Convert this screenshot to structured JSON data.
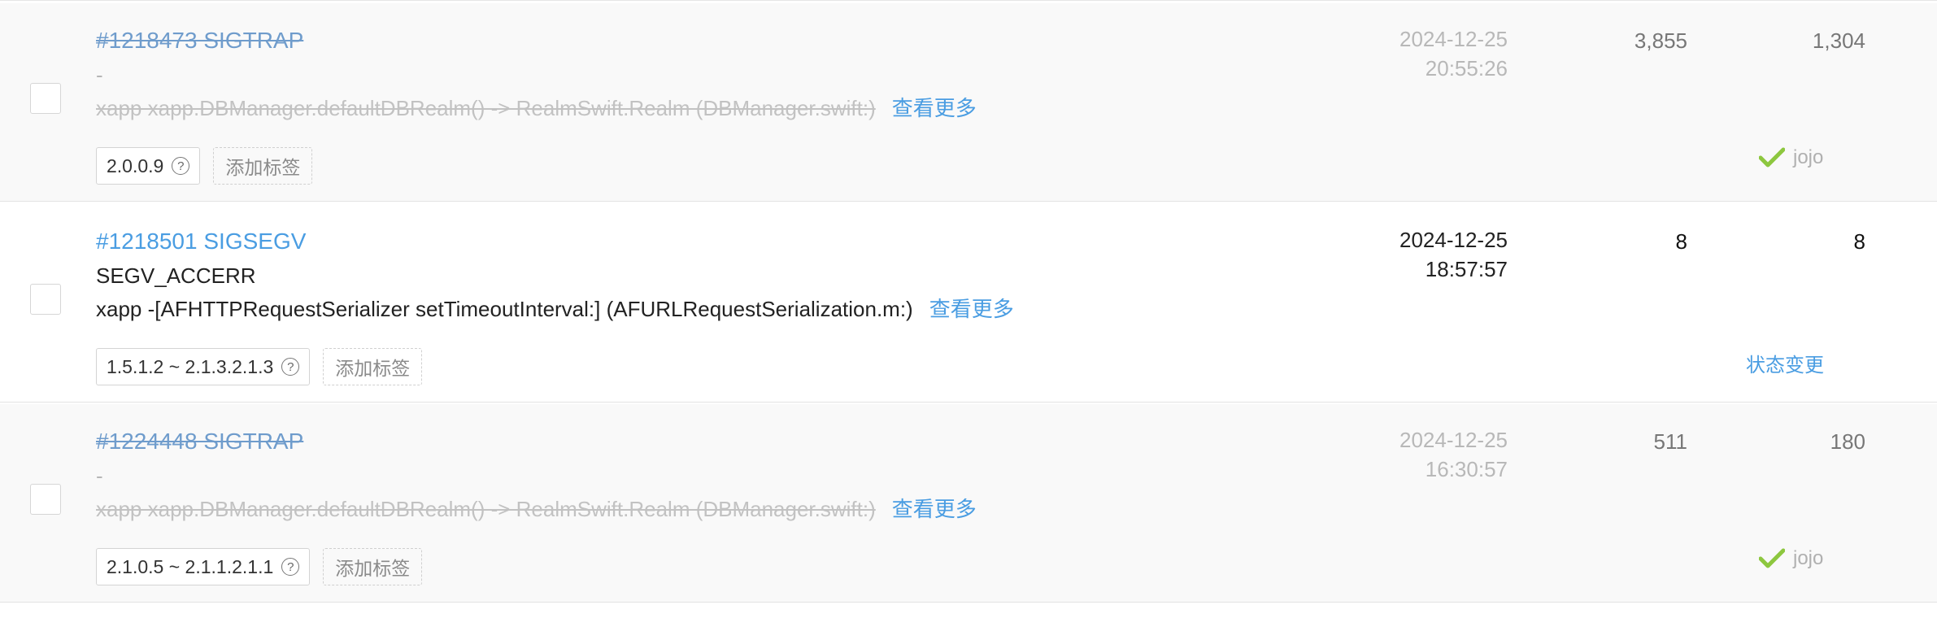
{
  "issues": [
    {
      "title": "#1218473 SIGTRAP",
      "reason": "-",
      "stack": "xapp xapp.DBManager.defaultDBRealm() -> RealmSwift.Realm (DBManager.swift:)",
      "more": "查看更多",
      "version": "2.0.0.9",
      "add_tag": "添加标签",
      "date": "2024-12-25",
      "time": "20:55:26",
      "count_a": "3,855",
      "count_b": "1,304",
      "assignee": "jojo"
    },
    {
      "title": "#1218501 SIGSEGV",
      "reason": "SEGV_ACCERR",
      "stack": "xapp -[AFHTTPRequestSerializer setTimeoutInterval:] (AFURLRequestSerialization.m:)",
      "more": "查看更多",
      "version": "1.5.1.2 ~ 2.1.3.2.1.3",
      "add_tag": "添加标签",
      "date": "2024-12-25",
      "time": "18:57:57",
      "count_a": "8",
      "count_b": "8",
      "status_action": "状态变更"
    },
    {
      "title": "#1224448 SIGTRAP",
      "reason": "-",
      "stack": "xapp xapp.DBManager.defaultDBRealm() -> RealmSwift.Realm (DBManager.swift:)",
      "more": "查看更多",
      "version": "2.1.0.5 ~ 2.1.1.2.1.1",
      "add_tag": "添加标签",
      "date": "2024-12-25",
      "time": "16:30:57",
      "count_a": "511",
      "count_b": "180",
      "assignee": "jojo"
    }
  ],
  "help_icon_glyph": "?",
  "icons": {
    "help": "question-circle-icon",
    "resolved": "check-icon"
  },
  "colors": {
    "link": "#4a9de2",
    "resolved_check": "#8dc73f",
    "resolved_row_bg": "#f9f9f9"
  }
}
